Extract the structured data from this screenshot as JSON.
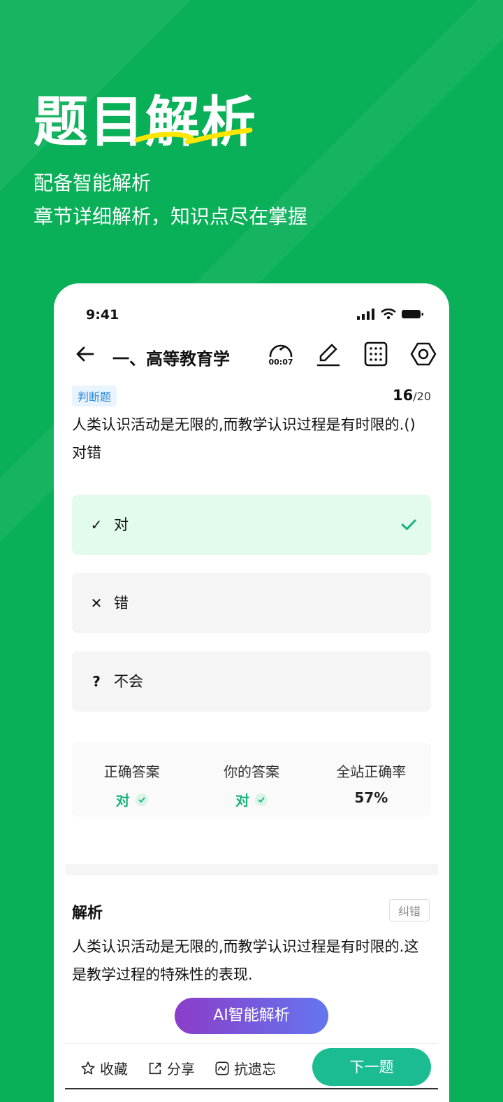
{
  "hero": {
    "title": "题目解析",
    "subtitle_1": "配备智能解析",
    "subtitle_2": "章节详细解析，知识点尽在掌握"
  },
  "status": {
    "time": "9:41"
  },
  "nav": {
    "title": "一、高等教育学",
    "timer": "00:07"
  },
  "question": {
    "type_tag": "判断题",
    "current": "16",
    "total": "/20",
    "text": "人类认识活动是无限的,而教学认识过程是有时限的.()对错"
  },
  "options": [
    {
      "symbol": "✓",
      "label": "对",
      "correct": true
    },
    {
      "symbol": "✕",
      "label": "错",
      "correct": false
    },
    {
      "symbol": "?",
      "label": "不会",
      "correct": false
    }
  ],
  "stats": {
    "correct_label": "正确答案",
    "correct_value": "对",
    "yours_label": "你的答案",
    "yours_value": "对",
    "rate_label": "全站正确率",
    "rate_value": "57%"
  },
  "analysis": {
    "title": "解析",
    "report_label": "纠错",
    "text": "人类认识活动是无限的,而教学认识过程是有时限的.这是教学过程的特殊性的表现."
  },
  "ai_button": "AI智能解析",
  "bottom": {
    "favorite": "收藏",
    "share": "分享",
    "anti_forget": "抗遗忘",
    "next": "下一题"
  },
  "colors": {
    "brand_green": "#09b058",
    "correct_green": "#1ab27d",
    "next_button": "#1cbc93"
  }
}
